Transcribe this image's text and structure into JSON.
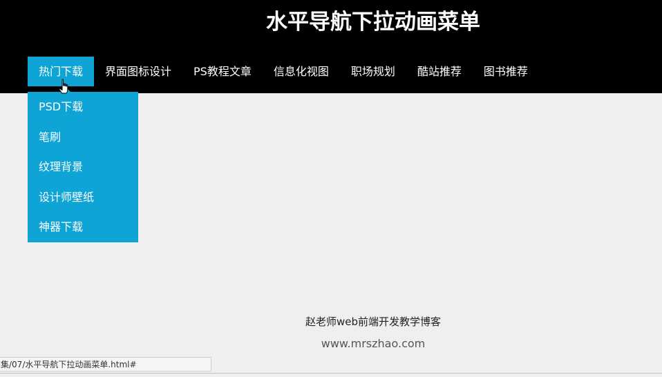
{
  "header": {
    "title": "水平导航下拉动画菜单"
  },
  "nav": {
    "items": [
      {
        "label": "热门下载",
        "active": true
      },
      {
        "label": "界面图标设计"
      },
      {
        "label": "PS教程文章"
      },
      {
        "label": "信息化视图"
      },
      {
        "label": "职场规划"
      },
      {
        "label": "酷站推荐"
      },
      {
        "label": "图书推荐"
      }
    ]
  },
  "dropdown": {
    "items": [
      {
        "label": "PSD下载"
      },
      {
        "label": "笔刷"
      },
      {
        "label": "纹理背景"
      },
      {
        "label": "设计师壁纸"
      },
      {
        "label": "神器下载"
      }
    ]
  },
  "footer": {
    "line1": "赵老师web前端开发教学博客",
    "line2": "www.mrszhao.com"
  },
  "status_bar": {
    "text": "集/07/水平导航下拉动画菜单.html#"
  },
  "colors": {
    "header_bg": "#000000",
    "accent": "#0ea5d6",
    "page_bg": "#f0eeee"
  },
  "icons": {
    "cursor": "hand-pointer-icon"
  }
}
